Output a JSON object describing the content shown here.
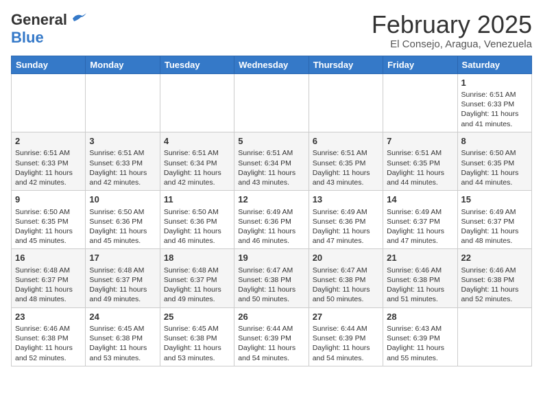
{
  "header": {
    "logo_line1": "General",
    "logo_line2": "Blue",
    "month_title": "February 2025",
    "location": "El Consejo, Aragua, Venezuela"
  },
  "weekdays": [
    "Sunday",
    "Monday",
    "Tuesday",
    "Wednesday",
    "Thursday",
    "Friday",
    "Saturday"
  ],
  "weeks": [
    [
      {
        "day": "",
        "text": ""
      },
      {
        "day": "",
        "text": ""
      },
      {
        "day": "",
        "text": ""
      },
      {
        "day": "",
        "text": ""
      },
      {
        "day": "",
        "text": ""
      },
      {
        "day": "",
        "text": ""
      },
      {
        "day": "1",
        "text": "Sunrise: 6:51 AM\nSunset: 6:33 PM\nDaylight: 11 hours and 41 minutes."
      }
    ],
    [
      {
        "day": "2",
        "text": "Sunrise: 6:51 AM\nSunset: 6:33 PM\nDaylight: 11 hours and 42 minutes."
      },
      {
        "day": "3",
        "text": "Sunrise: 6:51 AM\nSunset: 6:33 PM\nDaylight: 11 hours and 42 minutes."
      },
      {
        "day": "4",
        "text": "Sunrise: 6:51 AM\nSunset: 6:34 PM\nDaylight: 11 hours and 42 minutes."
      },
      {
        "day": "5",
        "text": "Sunrise: 6:51 AM\nSunset: 6:34 PM\nDaylight: 11 hours and 43 minutes."
      },
      {
        "day": "6",
        "text": "Sunrise: 6:51 AM\nSunset: 6:35 PM\nDaylight: 11 hours and 43 minutes."
      },
      {
        "day": "7",
        "text": "Sunrise: 6:51 AM\nSunset: 6:35 PM\nDaylight: 11 hours and 44 minutes."
      },
      {
        "day": "8",
        "text": "Sunrise: 6:50 AM\nSunset: 6:35 PM\nDaylight: 11 hours and 44 minutes."
      }
    ],
    [
      {
        "day": "9",
        "text": "Sunrise: 6:50 AM\nSunset: 6:35 PM\nDaylight: 11 hours and 45 minutes."
      },
      {
        "day": "10",
        "text": "Sunrise: 6:50 AM\nSunset: 6:36 PM\nDaylight: 11 hours and 45 minutes."
      },
      {
        "day": "11",
        "text": "Sunrise: 6:50 AM\nSunset: 6:36 PM\nDaylight: 11 hours and 46 minutes."
      },
      {
        "day": "12",
        "text": "Sunrise: 6:49 AM\nSunset: 6:36 PM\nDaylight: 11 hours and 46 minutes."
      },
      {
        "day": "13",
        "text": "Sunrise: 6:49 AM\nSunset: 6:36 PM\nDaylight: 11 hours and 47 minutes."
      },
      {
        "day": "14",
        "text": "Sunrise: 6:49 AM\nSunset: 6:37 PM\nDaylight: 11 hours and 47 minutes."
      },
      {
        "day": "15",
        "text": "Sunrise: 6:49 AM\nSunset: 6:37 PM\nDaylight: 11 hours and 48 minutes."
      }
    ],
    [
      {
        "day": "16",
        "text": "Sunrise: 6:48 AM\nSunset: 6:37 PM\nDaylight: 11 hours and 48 minutes."
      },
      {
        "day": "17",
        "text": "Sunrise: 6:48 AM\nSunset: 6:37 PM\nDaylight: 11 hours and 49 minutes."
      },
      {
        "day": "18",
        "text": "Sunrise: 6:48 AM\nSunset: 6:37 PM\nDaylight: 11 hours and 49 minutes."
      },
      {
        "day": "19",
        "text": "Sunrise: 6:47 AM\nSunset: 6:38 PM\nDaylight: 11 hours and 50 minutes."
      },
      {
        "day": "20",
        "text": "Sunrise: 6:47 AM\nSunset: 6:38 PM\nDaylight: 11 hours and 50 minutes."
      },
      {
        "day": "21",
        "text": "Sunrise: 6:46 AM\nSunset: 6:38 PM\nDaylight: 11 hours and 51 minutes."
      },
      {
        "day": "22",
        "text": "Sunrise: 6:46 AM\nSunset: 6:38 PM\nDaylight: 11 hours and 52 minutes."
      }
    ],
    [
      {
        "day": "23",
        "text": "Sunrise: 6:46 AM\nSunset: 6:38 PM\nDaylight: 11 hours and 52 minutes."
      },
      {
        "day": "24",
        "text": "Sunrise: 6:45 AM\nSunset: 6:38 PM\nDaylight: 11 hours and 53 minutes."
      },
      {
        "day": "25",
        "text": "Sunrise: 6:45 AM\nSunset: 6:38 PM\nDaylight: 11 hours and 53 minutes."
      },
      {
        "day": "26",
        "text": "Sunrise: 6:44 AM\nSunset: 6:39 PM\nDaylight: 11 hours and 54 minutes."
      },
      {
        "day": "27",
        "text": "Sunrise: 6:44 AM\nSunset: 6:39 PM\nDaylight: 11 hours and 54 minutes."
      },
      {
        "day": "28",
        "text": "Sunrise: 6:43 AM\nSunset: 6:39 PM\nDaylight: 11 hours and 55 minutes."
      },
      {
        "day": "",
        "text": ""
      }
    ]
  ]
}
